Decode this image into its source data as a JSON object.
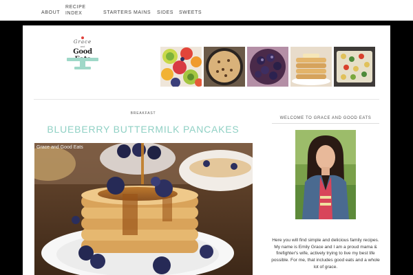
{
  "nav": {
    "items": [
      {
        "label": "ABOUT"
      },
      {
        "label": "RECIPE INDEX"
      },
      {
        "label": "STARTERS"
      },
      {
        "label": "MAINS"
      },
      {
        "label": "SIDES"
      },
      {
        "label": "SWEETS"
      }
    ]
  },
  "logo": {
    "script": "Grace",
    "and": "and",
    "name": "Good Eats"
  },
  "header_thumbs": [
    {
      "icon": "fruit-salad-photo"
    },
    {
      "icon": "cookie-skillet-photo"
    },
    {
      "icon": "blueberries-photo"
    },
    {
      "icon": "pancake-stack-photo"
    },
    {
      "icon": "pasta-salad-photo"
    }
  ],
  "post": {
    "category": "BREAKFAST",
    "title": "BLUEBERRY BUTTERMILK PANCAKES",
    "image_caption": "Grace and Good Eats"
  },
  "sidebar": {
    "widget_title": "WELCOME TO GRACE AND GOOD EATS",
    "bio": "Here you will find simple and delicious family recipes. My name is Emily Grace and I am a proud mama & firefighter's wife, actively trying to live my best life possible. For me, that includes good eats and a whole lot of grace."
  },
  "colors": {
    "accent": "#8fd0c4",
    "background": "#000000",
    "page": "#ffffff"
  }
}
